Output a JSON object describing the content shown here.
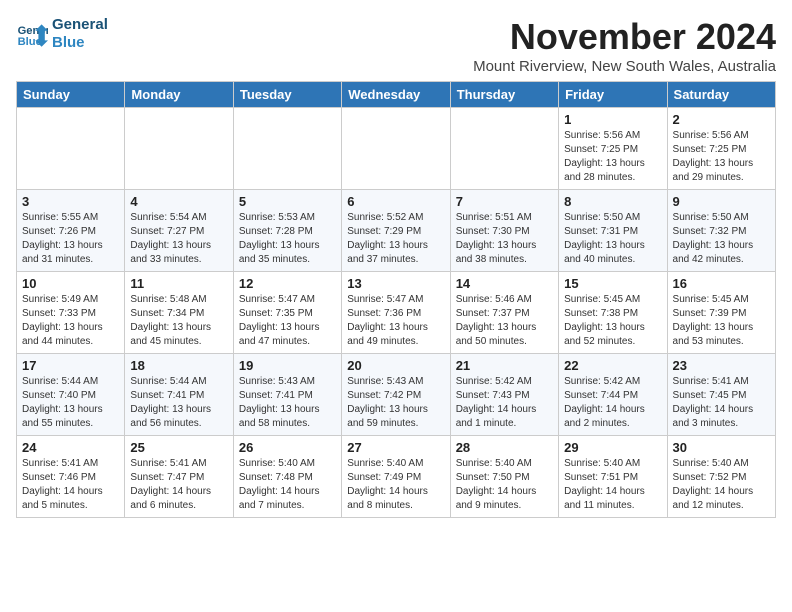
{
  "logo": {
    "line1": "General",
    "line2": "Blue"
  },
  "title": "November 2024",
  "location": "Mount Riverview, New South Wales, Australia",
  "days_header": [
    "Sunday",
    "Monday",
    "Tuesday",
    "Wednesday",
    "Thursday",
    "Friday",
    "Saturday"
  ],
  "weeks": [
    [
      {
        "day": "",
        "info": ""
      },
      {
        "day": "",
        "info": ""
      },
      {
        "day": "",
        "info": ""
      },
      {
        "day": "",
        "info": ""
      },
      {
        "day": "",
        "info": ""
      },
      {
        "day": "1",
        "info": "Sunrise: 5:56 AM\nSunset: 7:25 PM\nDaylight: 13 hours and 28 minutes."
      },
      {
        "day": "2",
        "info": "Sunrise: 5:56 AM\nSunset: 7:25 PM\nDaylight: 13 hours and 29 minutes."
      }
    ],
    [
      {
        "day": "3",
        "info": "Sunrise: 5:55 AM\nSunset: 7:26 PM\nDaylight: 13 hours and 31 minutes."
      },
      {
        "day": "4",
        "info": "Sunrise: 5:54 AM\nSunset: 7:27 PM\nDaylight: 13 hours and 33 minutes."
      },
      {
        "day": "5",
        "info": "Sunrise: 5:53 AM\nSunset: 7:28 PM\nDaylight: 13 hours and 35 minutes."
      },
      {
        "day": "6",
        "info": "Sunrise: 5:52 AM\nSunset: 7:29 PM\nDaylight: 13 hours and 37 minutes."
      },
      {
        "day": "7",
        "info": "Sunrise: 5:51 AM\nSunset: 7:30 PM\nDaylight: 13 hours and 38 minutes."
      },
      {
        "day": "8",
        "info": "Sunrise: 5:50 AM\nSunset: 7:31 PM\nDaylight: 13 hours and 40 minutes."
      },
      {
        "day": "9",
        "info": "Sunrise: 5:50 AM\nSunset: 7:32 PM\nDaylight: 13 hours and 42 minutes."
      }
    ],
    [
      {
        "day": "10",
        "info": "Sunrise: 5:49 AM\nSunset: 7:33 PM\nDaylight: 13 hours and 44 minutes."
      },
      {
        "day": "11",
        "info": "Sunrise: 5:48 AM\nSunset: 7:34 PM\nDaylight: 13 hours and 45 minutes."
      },
      {
        "day": "12",
        "info": "Sunrise: 5:47 AM\nSunset: 7:35 PM\nDaylight: 13 hours and 47 minutes."
      },
      {
        "day": "13",
        "info": "Sunrise: 5:47 AM\nSunset: 7:36 PM\nDaylight: 13 hours and 49 minutes."
      },
      {
        "day": "14",
        "info": "Sunrise: 5:46 AM\nSunset: 7:37 PM\nDaylight: 13 hours and 50 minutes."
      },
      {
        "day": "15",
        "info": "Sunrise: 5:45 AM\nSunset: 7:38 PM\nDaylight: 13 hours and 52 minutes."
      },
      {
        "day": "16",
        "info": "Sunrise: 5:45 AM\nSunset: 7:39 PM\nDaylight: 13 hours and 53 minutes."
      }
    ],
    [
      {
        "day": "17",
        "info": "Sunrise: 5:44 AM\nSunset: 7:40 PM\nDaylight: 13 hours and 55 minutes."
      },
      {
        "day": "18",
        "info": "Sunrise: 5:44 AM\nSunset: 7:41 PM\nDaylight: 13 hours and 56 minutes."
      },
      {
        "day": "19",
        "info": "Sunrise: 5:43 AM\nSunset: 7:41 PM\nDaylight: 13 hours and 58 minutes."
      },
      {
        "day": "20",
        "info": "Sunrise: 5:43 AM\nSunset: 7:42 PM\nDaylight: 13 hours and 59 minutes."
      },
      {
        "day": "21",
        "info": "Sunrise: 5:42 AM\nSunset: 7:43 PM\nDaylight: 14 hours and 1 minute."
      },
      {
        "day": "22",
        "info": "Sunrise: 5:42 AM\nSunset: 7:44 PM\nDaylight: 14 hours and 2 minutes."
      },
      {
        "day": "23",
        "info": "Sunrise: 5:41 AM\nSunset: 7:45 PM\nDaylight: 14 hours and 3 minutes."
      }
    ],
    [
      {
        "day": "24",
        "info": "Sunrise: 5:41 AM\nSunset: 7:46 PM\nDaylight: 14 hours and 5 minutes."
      },
      {
        "day": "25",
        "info": "Sunrise: 5:41 AM\nSunset: 7:47 PM\nDaylight: 14 hours and 6 minutes."
      },
      {
        "day": "26",
        "info": "Sunrise: 5:40 AM\nSunset: 7:48 PM\nDaylight: 14 hours and 7 minutes."
      },
      {
        "day": "27",
        "info": "Sunrise: 5:40 AM\nSunset: 7:49 PM\nDaylight: 14 hours and 8 minutes."
      },
      {
        "day": "28",
        "info": "Sunrise: 5:40 AM\nSunset: 7:50 PM\nDaylight: 14 hours and 9 minutes."
      },
      {
        "day": "29",
        "info": "Sunrise: 5:40 AM\nSunset: 7:51 PM\nDaylight: 14 hours and 11 minutes."
      },
      {
        "day": "30",
        "info": "Sunrise: 5:40 AM\nSunset: 7:52 PM\nDaylight: 14 hours and 12 minutes."
      }
    ]
  ]
}
